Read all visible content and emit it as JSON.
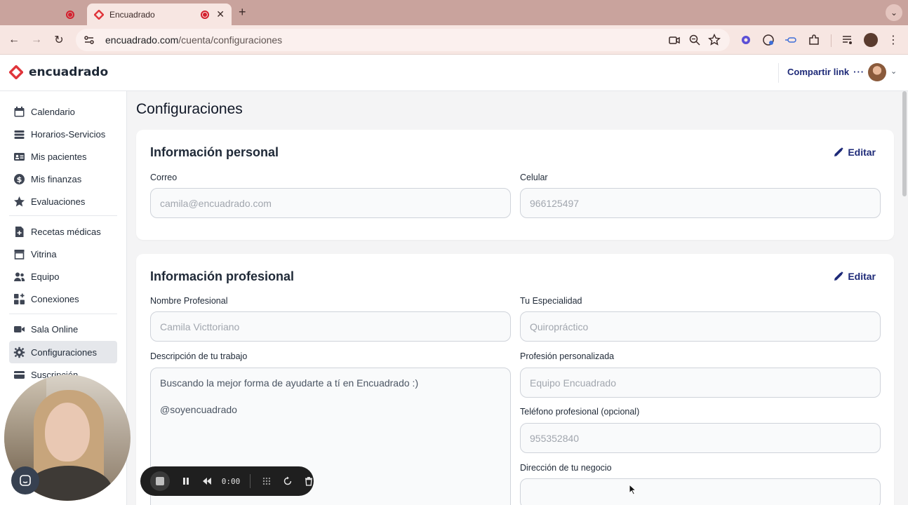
{
  "browser": {
    "active_tab_title": "Encuadrado",
    "url_domain": "encuadrado.com",
    "url_path": "/cuenta/configuraciones"
  },
  "header": {
    "brand": "encuadrado",
    "share_label": "Compartir link",
    "share_dots": "···"
  },
  "sidebar": {
    "items": [
      {
        "label": "Calendario"
      },
      {
        "label": "Horarios-Servicios"
      },
      {
        "label": "Mis pacientes"
      },
      {
        "label": "Mis finanzas"
      },
      {
        "label": "Evaluaciones"
      },
      {
        "label": "Recetas médicas"
      },
      {
        "label": "Vitrina"
      },
      {
        "label": "Equipo"
      },
      {
        "label": "Conexiones"
      },
      {
        "label": "Sala Online"
      },
      {
        "label": "Configuraciones"
      },
      {
        "label": "Suscripción"
      }
    ],
    "active": "Configuraciones"
  },
  "main": {
    "title": "Configuraciones",
    "personal": {
      "title": "Información personal",
      "edit_label": "Editar",
      "email_label": "Correo",
      "email_value": "camila@encuadrado.com",
      "phone_label": "Celular",
      "phone_value": "966125497"
    },
    "professional": {
      "title": "Información profesional",
      "edit_label": "Editar",
      "name_label": "Nombre Profesional",
      "name_value": "Camila Victtoriano",
      "specialty_label": "Tu Especialidad",
      "specialty_value": "Quiropráctico",
      "description_label": "Descripción de tu trabajo",
      "description_line1": "Buscando la mejor forma de ayudarte a tí en Encuadrado :)",
      "description_line2": "@soyencuadrado",
      "custom_profession_label": "Profesión personalizada",
      "custom_profession_value": "Equipo Encuadrado",
      "pro_phone_label": "Teléfono profesional (opcional)",
      "pro_phone_value": "955352840",
      "address_label": "Dirección de tu negocio",
      "address_value": ""
    }
  },
  "recorder": {
    "time": "0:00"
  },
  "colors": {
    "brand_red": "#e0353b",
    "accent_navy": "#1e2a78",
    "chrome_tabbar": "#c9a39d"
  }
}
